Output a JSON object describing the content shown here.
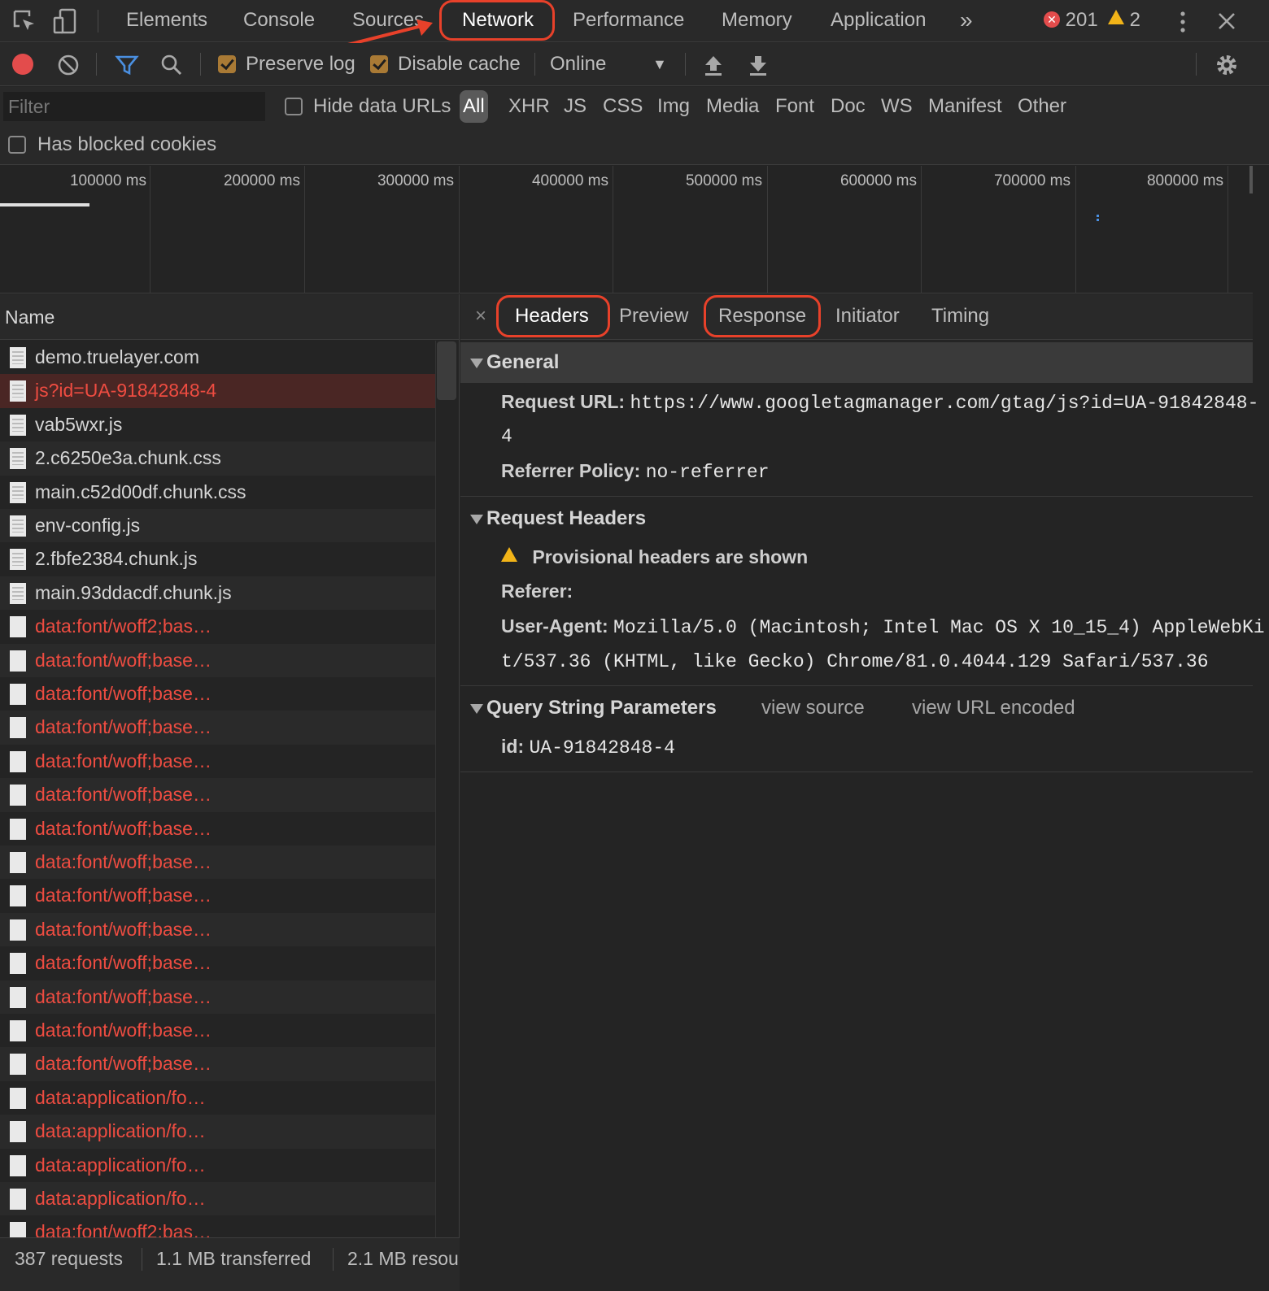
{
  "top_tabs": {
    "elements": "Elements",
    "console": "Console",
    "sources": "Sources",
    "network": "Network",
    "performance": "Performance",
    "memory": "Memory",
    "application": "Application",
    "more": "»"
  },
  "counts": {
    "errors": "201",
    "warnings": "2"
  },
  "toolbar": {
    "preserve_log": "Preserve log",
    "disable_cache": "Disable cache",
    "throttling": "Online"
  },
  "filter": {
    "placeholder": "Filter",
    "hide_data_urls": "Hide data URLs",
    "types": [
      "All",
      "XHR",
      "JS",
      "CSS",
      "Img",
      "Media",
      "Font",
      "Doc",
      "WS",
      "Manifest",
      "Other"
    ],
    "has_blocked_cookies": "Has blocked cookies"
  },
  "overview": {
    "ticks": [
      "100000 ms",
      "200000 ms",
      "300000 ms",
      "400000 ms",
      "500000 ms",
      "600000 ms",
      "700000 ms",
      "800000 ms"
    ]
  },
  "list": {
    "header": "Name",
    "rows": [
      "demo.truelayer.com",
      "js?id=UA-91842848-4",
      "vab5wxr.js",
      "2.c6250e3a.chunk.css",
      "main.c52d00df.chunk.css",
      "env-config.js",
      "2.fbfe2384.chunk.js",
      "main.93ddacdf.chunk.js",
      "data:font/woff2;bas…",
      "data:font/woff;base…",
      "data:font/woff;base…",
      "data:font/woff;base…",
      "data:font/woff;base…",
      "data:font/woff;base…",
      "data:font/woff;base…",
      "data:font/woff;base…",
      "data:font/woff;base…",
      "data:font/woff;base…",
      "data:font/woff;base…",
      "data:font/woff;base…",
      "data:font/woff;base…",
      "data:font/woff;base…",
      "data:application/fo…",
      "data:application/fo…",
      "data:application/fo…",
      "data:application/fo…",
      "data:font/woff2;bas…"
    ]
  },
  "status": {
    "requests": "387 requests",
    "transferred": "1.1 MB transferred",
    "resources": "2.1 MB resou"
  },
  "detail_tabs": {
    "close": "×",
    "headers": "Headers",
    "preview": "Preview",
    "response": "Response",
    "initiator": "Initiator",
    "timing": "Timing"
  },
  "general": {
    "title": "General",
    "request_url_label": "Request URL:",
    "request_url_line1": "https://www.googletagmanager.com/gtag/js?id=UA-91842848-",
    "request_url_line2": "4",
    "referrer_policy_label": "Referrer Policy:",
    "referrer_policy_value": "no-referrer"
  },
  "request_headers": {
    "title": "Request Headers",
    "provisional": "Provisional headers are shown",
    "referer_label": "Referer:",
    "user_agent_label": "User-Agent:",
    "user_agent_line1": "Mozilla/5.0 (Macintosh; Intel Mac OS X 10_15_4) AppleWebKi",
    "user_agent_line2": "t/537.36 (KHTML, like Gecko) Chrome/81.0.4044.129 Safari/537.36"
  },
  "query_params": {
    "title": "Query String Parameters",
    "view_source": "view source",
    "view_url_encoded": "view URL encoded",
    "id_label": "id:",
    "id_value": "UA-91842848-4"
  },
  "colors": {
    "highlight": "#e8412a",
    "error_text": "#ee4c41",
    "record": "#e34c4c",
    "filter_blue": "#4a8fe0"
  }
}
